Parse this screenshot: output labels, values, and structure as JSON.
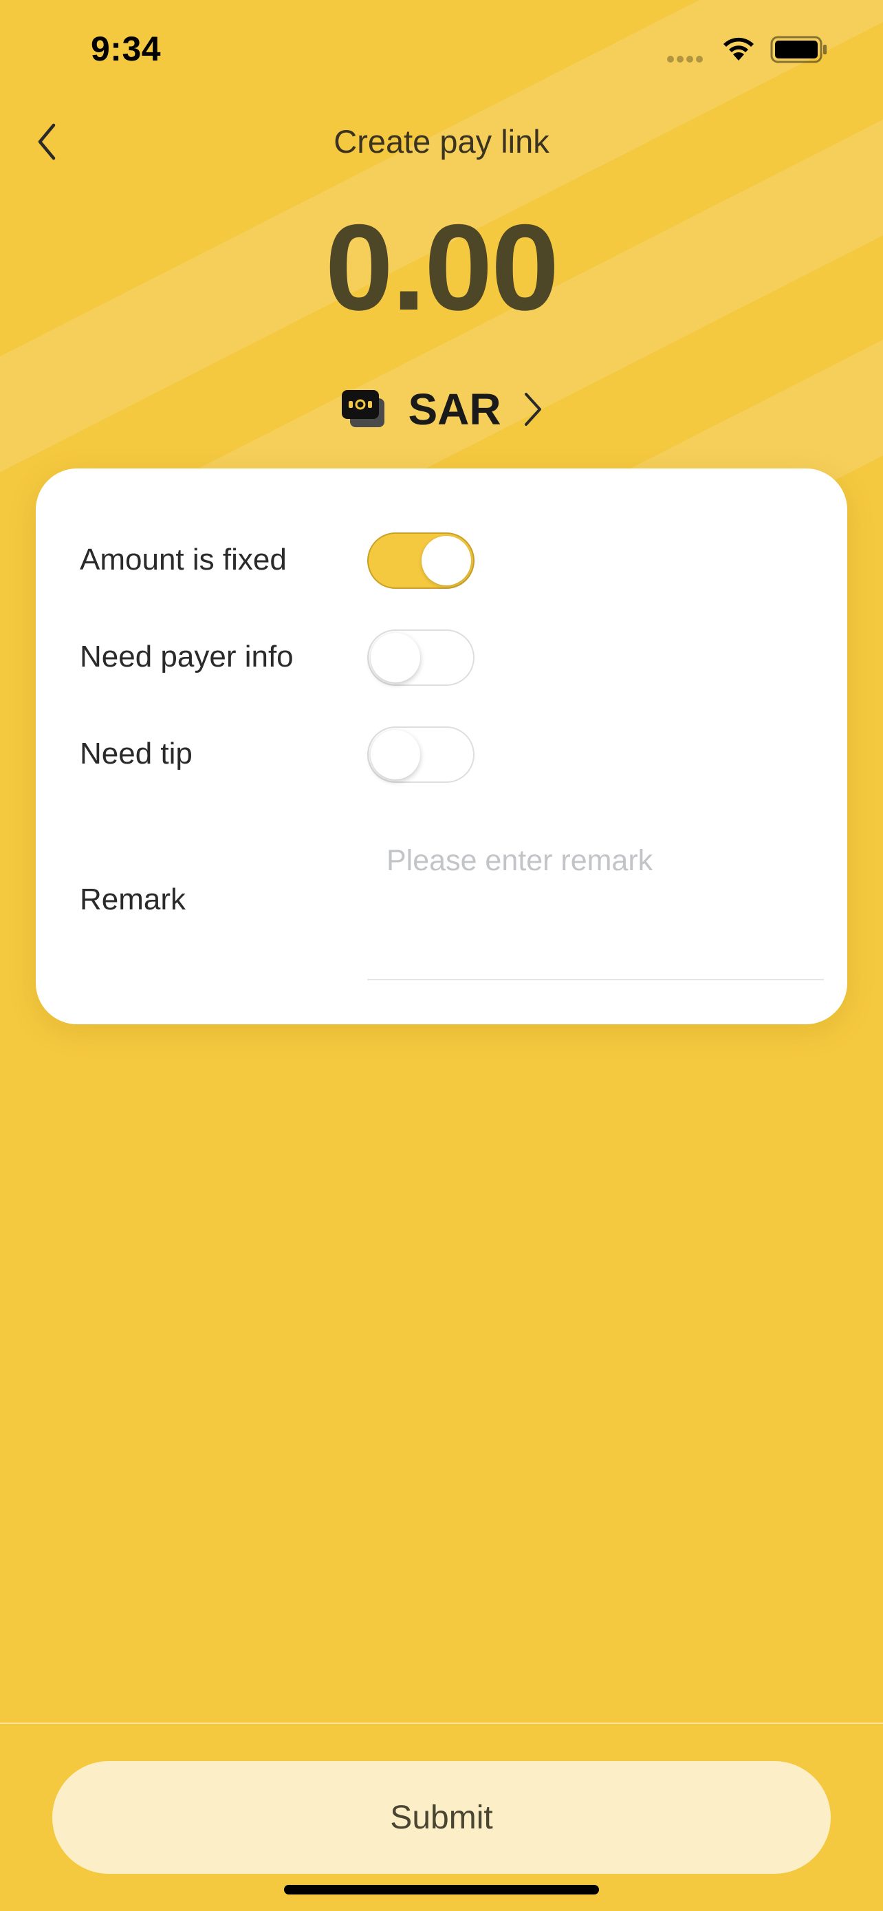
{
  "status_bar": {
    "time": "9:34"
  },
  "header": {
    "title": "Create pay link",
    "back_icon": "chevron-left-icon"
  },
  "amount": {
    "value": "0.00",
    "currency_code": "SAR",
    "currency_icon": "wallet-icon"
  },
  "form": {
    "amount_fixed": {
      "label": "Amount is fixed",
      "on": true
    },
    "need_payer_info": {
      "label": "Need payer info",
      "on": false
    },
    "need_tip": {
      "label": "Need tip",
      "on": false
    },
    "remark": {
      "label": "Remark",
      "value": "",
      "placeholder": "Please enter remark"
    }
  },
  "footer": {
    "submit_label": "Submit"
  },
  "colors": {
    "background": "#F4C83F",
    "amount_text": "#4D4627",
    "toggle_on": "#F4C83F",
    "submit_bg": "#FCEFC7"
  }
}
